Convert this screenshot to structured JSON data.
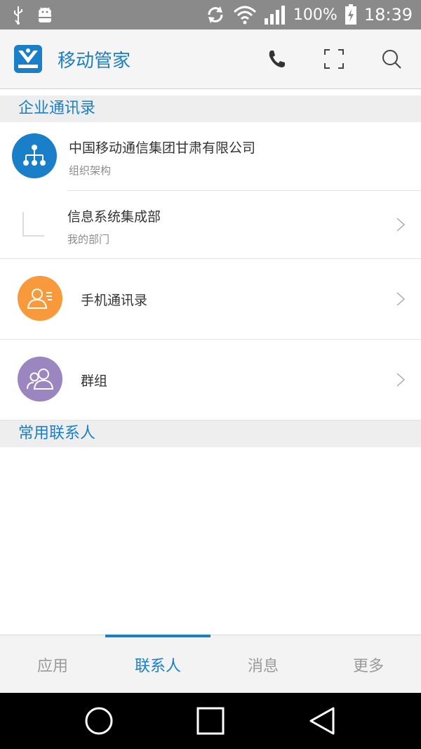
{
  "status_bar": {
    "icons": [
      "usb-icon",
      "android-debug-icon",
      "sync-icon",
      "wifi-icon",
      "signal-icon",
      "battery-charging-icon"
    ],
    "battery": "100%",
    "time": "18:39"
  },
  "app_bar": {
    "title": "移动管家",
    "actions": [
      "phone-icon",
      "scan-icon",
      "search-icon"
    ]
  },
  "enterprise_section": {
    "header": "企业通讯录",
    "org": {
      "title": "中国移动通信集团甘肃有限公司",
      "subtitle": "组织架构"
    },
    "dept": {
      "title": "信息系统集成部",
      "subtitle": "我的部门"
    },
    "phone_contacts": {
      "title": "手机通讯录"
    },
    "groups": {
      "title": "群组"
    }
  },
  "frequent_section": {
    "header": "常用联系人"
  },
  "bottom_nav": {
    "tabs": [
      "应用",
      "联系人",
      "消息",
      "更多"
    ],
    "active_index": 1
  },
  "colors": {
    "accent": "#1a7fc9",
    "org_icon": "#1a7fc9",
    "phone_contacts_icon": "#f89a3c",
    "groups_icon": "#9b86c0"
  }
}
